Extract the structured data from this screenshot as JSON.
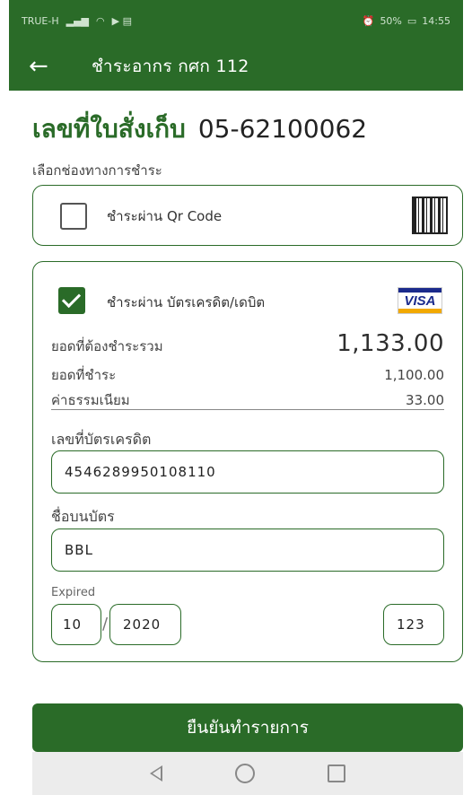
{
  "status_bar": {
    "carrier": "TRUE-H",
    "battery": "50%",
    "time": "14:55"
  },
  "app_bar": {
    "title": "ชำระอากร กศก 112"
  },
  "page": {
    "heading_label": "เลขที่ใบสั่งเก็บ",
    "heading_number": "05-62100062",
    "section_label": "เลือกช่องทางการชำระ"
  },
  "payment_options": {
    "qr": {
      "label": "ชำระผ่าน Qr Code",
      "checked": false
    },
    "card": {
      "label": "ชำระผ่าน บัตรเครดิต/เดบิต",
      "checked": true,
      "brand": "VISA"
    }
  },
  "amounts": {
    "total_label": "ยอดที่ต้องชำระรวม",
    "total_value": "1,133.00",
    "pay_label": "ยอดที่ชำระ",
    "pay_value": "1,100.00",
    "fee_label": "ค่าธรรมเนียม",
    "fee_value": "33.00"
  },
  "form": {
    "card_number_label": "เลขที่บัตรเครดิต",
    "card_number_value": "4546289950108110",
    "card_name_label": "ชื่อบนบัตร",
    "card_name_value": "BBL",
    "expired_label": "Expired",
    "exp_month": "10",
    "exp_separator": "/",
    "exp_year": "2020",
    "cvv": "123"
  },
  "confirm_button": {
    "label": "ยืนยันทำรายการ"
  }
}
